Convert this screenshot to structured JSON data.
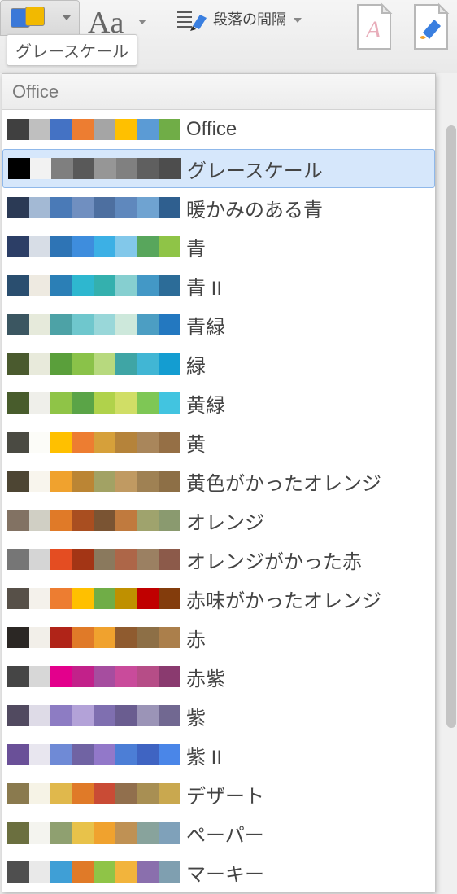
{
  "toolbar": {
    "tooltip": "グレースケール",
    "fonts_label": "Aa",
    "spacing_label": "段落の間隔"
  },
  "panel": {
    "header": "Office",
    "selected_index": 1,
    "themes": [
      {
        "name": "Office",
        "colors": [
          "#404040",
          "#bfbfbf",
          "#4472c4",
          "#ed7d31",
          "#a5a5a5",
          "#ffc000",
          "#5b9bd5",
          "#70ad47"
        ]
      },
      {
        "name": "グレースケール",
        "colors": [
          "#000000",
          "#f2f2f2",
          "#7f7f7f",
          "#595959",
          "#969696",
          "#808080",
          "#5f5f5f",
          "#4d4d4d"
        ]
      },
      {
        "name": "暖かみのある青",
        "colors": [
          "#2b3a55",
          "#a3b9d4",
          "#4a7ab7",
          "#708fc0",
          "#4d6fa0",
          "#5f88bd",
          "#6fa3d1",
          "#2f5f8f"
        ]
      },
      {
        "name": "青",
        "colors": [
          "#2c3e66",
          "#d7dde6",
          "#2e74b5",
          "#3e8ddd",
          "#3cb0e5",
          "#82c8ea",
          "#58a65c",
          "#8fc447"
        ]
      },
      {
        "name": "青 II",
        "colors": [
          "#2a4e6f",
          "#eeeae1",
          "#2b7fb6",
          "#2eb7cf",
          "#34b0ae",
          "#86cfd0",
          "#4398c6",
          "#2c6c98"
        ]
      },
      {
        "name": "青緑",
        "colors": [
          "#3b5661",
          "#e6eadb",
          "#4da2a6",
          "#6fc7cd",
          "#99d7d9",
          "#cde8db",
          "#4c9ec3",
          "#2378c0"
        ]
      },
      {
        "name": "緑",
        "colors": [
          "#4a5a2e",
          "#e8eadb",
          "#5a9f3b",
          "#8ac249",
          "#b7d97e",
          "#3fa5a5",
          "#41b6d4",
          "#149dd1"
        ]
      },
      {
        "name": "黄緑",
        "colors": [
          "#485c2c",
          "#efefea",
          "#8fc447",
          "#5aa447",
          "#b0d24b",
          "#d0de66",
          "#7ec755",
          "#42c4e0"
        ]
      },
      {
        "name": "黄",
        "colors": [
          "#4a4a42",
          "#fcfcf8",
          "#ffc000",
          "#ed7d31",
          "#d6a03a",
          "#b5833a",
          "#a9865b",
          "#956f45"
        ]
      },
      {
        "name": "黄色がかったオレンジ",
        "colors": [
          "#4d4533",
          "#f8f5ed",
          "#f0a22e",
          "#bb8534",
          "#a2a264",
          "#c09a62",
          "#9f8153",
          "#8d6f46"
        ]
      },
      {
        "name": "オレンジ",
        "colors": [
          "#827263",
          "#d0cfc4",
          "#e07a28",
          "#a94e20",
          "#7a5433",
          "#c07a3e",
          "#9fa36d",
          "#8a9a6f"
        ]
      },
      {
        "name": "オレンジがかった赤",
        "colors": [
          "#767676",
          "#d5d5d5",
          "#e44d22",
          "#a33515",
          "#8a795d",
          "#ad6648",
          "#9b8062",
          "#8c5a4a"
        ]
      },
      {
        "name": "赤味がかったオレンジ",
        "colors": [
          "#575048",
          "#f4f1eb",
          "#ed7d31",
          "#ffc000",
          "#70ad47",
          "#bf9000",
          "#c00000",
          "#833c0c"
        ]
      },
      {
        "name": "赤",
        "colors": [
          "#2b2724",
          "#f2efe9",
          "#b02418",
          "#e07a28",
          "#f0a22e",
          "#8f5b2f",
          "#8d6f46",
          "#ab7f4b"
        ]
      },
      {
        "name": "赤紫",
        "colors": [
          "#454545",
          "#d7d7d7",
          "#e3008c",
          "#c2218a",
          "#a64d9f",
          "#c94b9b",
          "#b64d87",
          "#8a3a6f"
        ]
      },
      {
        "name": "紫",
        "colors": [
          "#514a60",
          "#dedbe7",
          "#8d7cc3",
          "#b3a2d8",
          "#7f6fb0",
          "#6a5d90",
          "#9b94b7",
          "#716891"
        ]
      },
      {
        "name": "紫 II",
        "colors": [
          "#6a5098",
          "#e8e6ef",
          "#6f8ad6",
          "#7063a3",
          "#9278c9",
          "#4c7ed6",
          "#3f64c2",
          "#4a86e8"
        ]
      },
      {
        "name": "デザート",
        "colors": [
          "#8a7a4e",
          "#f6f3e6",
          "#e0b84c",
          "#e07a28",
          "#c94b35",
          "#916f4d",
          "#a88f53",
          "#c9a84f"
        ]
      },
      {
        "name": "ペーパー",
        "colors": [
          "#6b6f3f",
          "#f4f4ef",
          "#8fa070",
          "#e8c24a",
          "#f0a22e",
          "#bf9154",
          "#88a39c",
          "#7fa1ba"
        ]
      },
      {
        "name": "マーキー",
        "colors": [
          "#4f4f4f",
          "#e9e9e9",
          "#3f9fd6",
          "#e07a28",
          "#8fc447",
          "#f2b43c",
          "#8a6fad",
          "#7f9fb0"
        ]
      }
    ]
  }
}
